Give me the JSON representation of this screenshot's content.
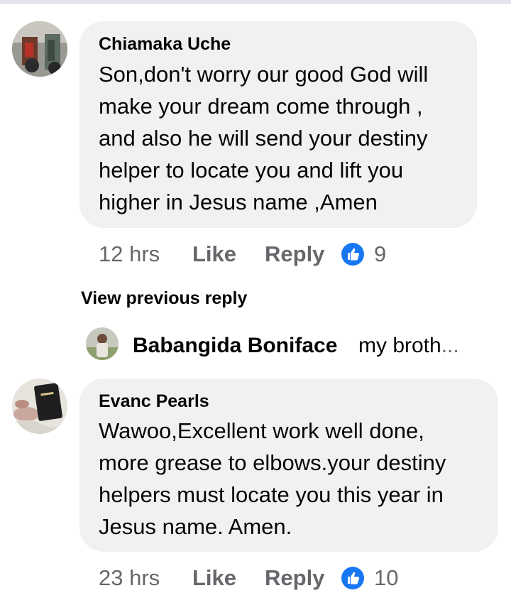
{
  "comments": [
    {
      "author": "Chiamaka Uche",
      "lines": [
        "Son,don't worry our good God will",
        "make your dream come through ,",
        "and also he will send your destiny",
        "helper to locate you and lift you",
        "higher in Jesus name ,Amen"
      ],
      "time": "12 hrs",
      "like_label": "Like",
      "reply_label": "Reply",
      "reaction_count": "9",
      "avatar_icon": "motorcycle-photo-avatar"
    },
    {
      "author": "Evanc Pearls",
      "lines": [
        "Wawoo,Excellent work well done,",
        "more grease to elbows.your destiny",
        "helpers must locate you this year in",
        "Jesus name. Amen."
      ],
      "time": "23 hrs",
      "like_label": "Like",
      "reply_label": "Reply",
      "reaction_count": "10",
      "avatar_icon": "bible-photo-avatar"
    }
  ],
  "replies_section": {
    "view_previous_label": "View previous reply",
    "reply_author": "Babangida Boniface",
    "reply_preview": "my broth",
    "ellipsis": "..."
  },
  "colors": {
    "bubble": "#eff1f3",
    "meta_text": "#65676b",
    "like_blue": "#1877f2"
  }
}
